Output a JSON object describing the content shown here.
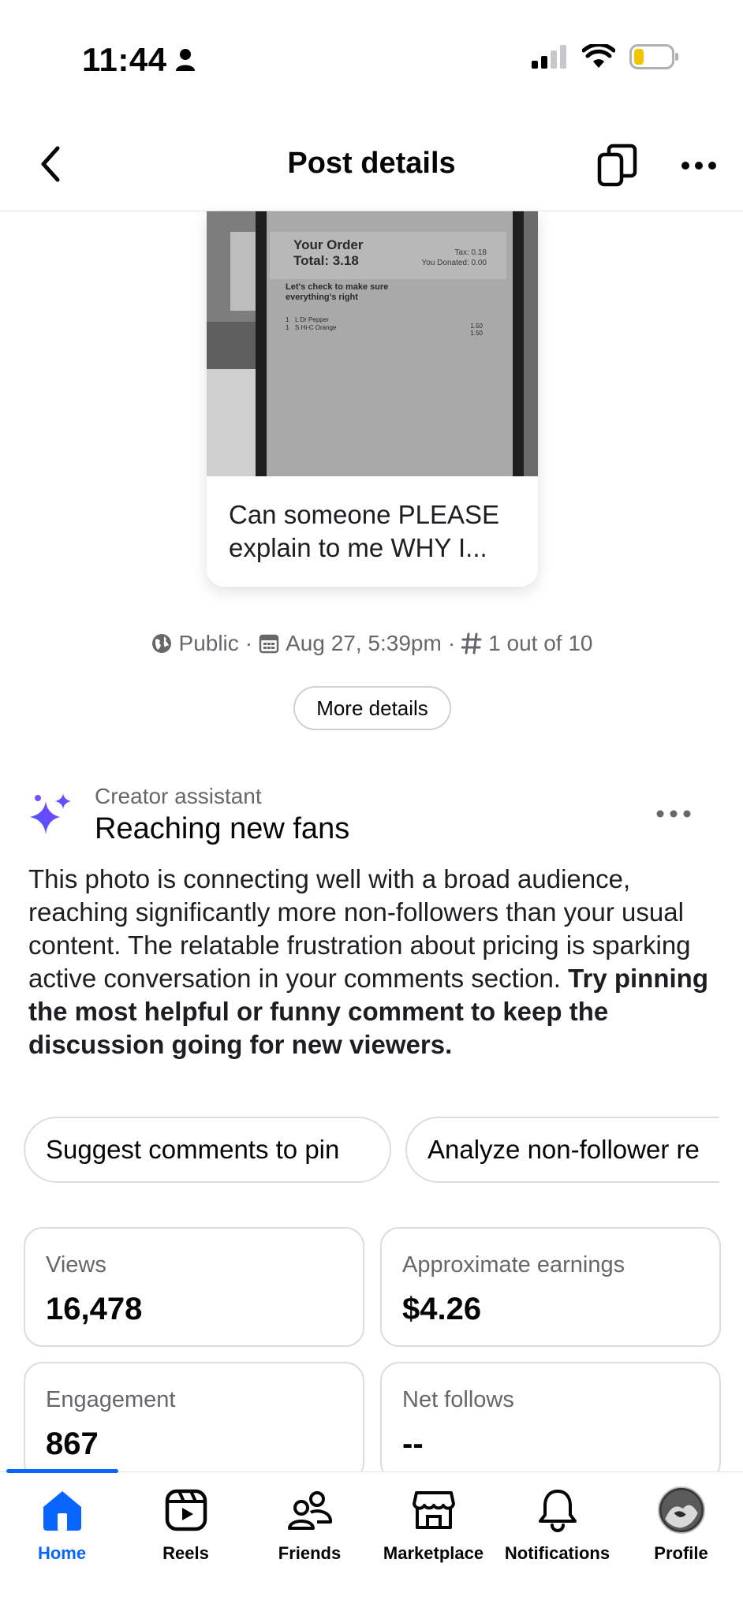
{
  "status_bar": {
    "time": "11:44",
    "icons": [
      "person-icon",
      "cellular-signal-icon",
      "wifi-icon",
      "battery-low-icon"
    ]
  },
  "header": {
    "title": "Post details",
    "icons": [
      "back-arrow-icon",
      "copy-icon",
      "more-options-icon"
    ]
  },
  "post": {
    "caption": "Can someone PLEASE explain to me WHY I...",
    "image_text": {
      "heading": "Your Order",
      "total": "Total: 3.18",
      "tax": "Tax: 0.18",
      "donated": "You Donated: 0.00",
      "check": "Let's check to make sure everything's right",
      "items": [
        {
          "qty": "1",
          "name": "L Dr Pepper",
          "price": "1.50"
        },
        {
          "qty": "1",
          "name": "S Hi-C Orange",
          "price": "1.50"
        }
      ]
    }
  },
  "meta": {
    "visibility": "Public",
    "date": "Aug 27, 5:39pm",
    "rank": "1 out of 10",
    "separator": "·",
    "more_details_label": "More details"
  },
  "creator_assistant": {
    "label": "Creator assistant",
    "title": "Reaching new fans",
    "body_plain": "This photo is connecting well with a broad audience, reaching significantly more non-followers than your usual content. The relatable frustration about pricing is sparking active conversation in your comments section.",
    "body_bold": "Try pinning the most helpful or funny comment to keep the discussion going for new viewers.",
    "chips": [
      "Suggest comments to pin",
      "Analyze non-follower re"
    ]
  },
  "stats": [
    {
      "label": "Views",
      "value": "16,478"
    },
    {
      "label": "Approximate earnings",
      "value": "$4.26"
    },
    {
      "label": "Engagement",
      "value": "867"
    },
    {
      "label": "Net follows",
      "value": "--"
    }
  ],
  "nav": {
    "items": [
      {
        "label": "Home",
        "icon": "home-icon",
        "active": true
      },
      {
        "label": "Reels",
        "icon": "reels-icon",
        "active": false
      },
      {
        "label": "Friends",
        "icon": "friends-icon",
        "active": false
      },
      {
        "label": "Marketplace",
        "icon": "marketplace-icon",
        "active": false
      },
      {
        "label": "Notifications",
        "icon": "bell-icon",
        "active": false
      },
      {
        "label": "Profile",
        "icon": "profile-avatar",
        "active": false
      }
    ]
  },
  "colors": {
    "accent": "#0866ff",
    "secondary_text": "#65676b",
    "assistant_gradient_start": "#3b5bfd",
    "assistant_gradient_end": "#8a3ffc"
  }
}
